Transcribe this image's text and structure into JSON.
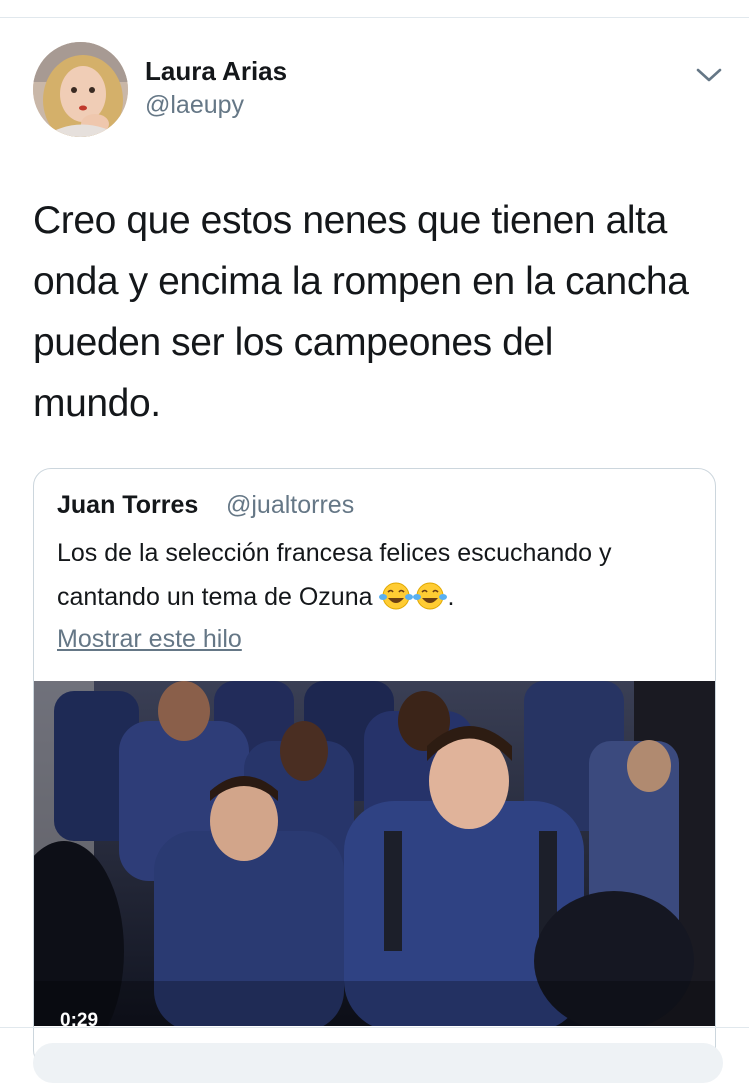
{
  "tweet": {
    "author_name": "Laura Arias",
    "author_handle": "@laeupy",
    "text": "Creo que estos nenes que tienen alta\nonda y encima la rompen en la cancha\npueden ser los campeones del\nmundo."
  },
  "quoted_tweet": {
    "author_name": "Juan Torres",
    "author_handle": "@jualtorres",
    "text": "Los de la selección francesa felices escuchando y cantando un tema de Ozuna",
    "text_suffix": ".",
    "emojis": [
      "face-with-tears-of-joy-icon",
      "face-with-tears-of-joy-icon"
    ],
    "show_thread_label": "Mostrar este hilo",
    "video": {
      "timestamp": "0:29"
    }
  },
  "icons": {
    "menu": "chevron-down-icon"
  },
  "colors": {
    "text": "#14171a",
    "secondary": "#657786",
    "border": "#ccd6dd",
    "jersey": "#2a3a6e"
  }
}
